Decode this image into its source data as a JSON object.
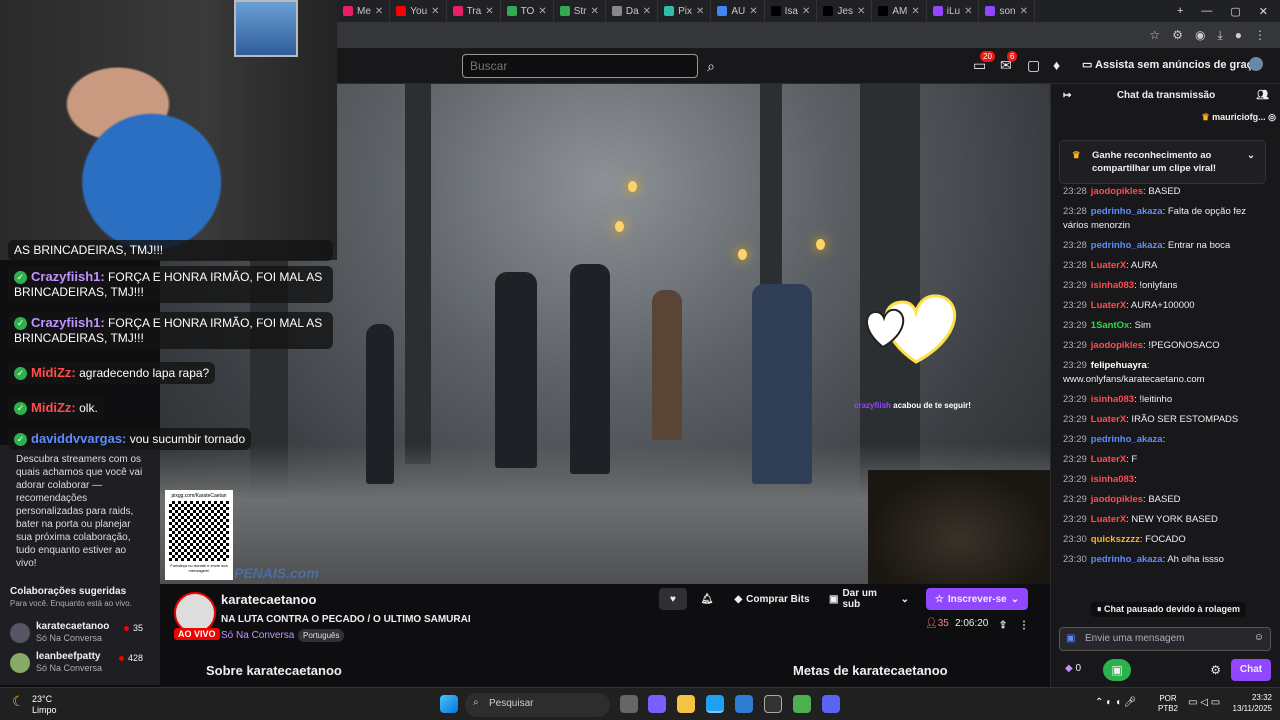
{
  "browser": {
    "tabs": [
      {
        "label": "Me",
        "color": "#e91e63"
      },
      {
        "label": "You",
        "color": "#ff0000"
      },
      {
        "label": "Tra",
        "color": "#e91e63"
      },
      {
        "label": "TO",
        "color": "#34a853"
      },
      {
        "label": "Str",
        "color": "#34a853"
      },
      {
        "label": "Da",
        "color": "#888888"
      },
      {
        "label": "Pix",
        "color": "#32bcad"
      },
      {
        "label": "AU",
        "color": "#4285f4"
      },
      {
        "label": "Isa",
        "color": "#000000"
      },
      {
        "label": "Jes",
        "color": "#000000"
      },
      {
        "label": "AM",
        "color": "#000000"
      },
      {
        "label": "iLu",
        "color": "#9147ff"
      },
      {
        "label": "son",
        "color": "#9147ff"
      }
    ]
  },
  "nav": {
    "search_placeholder": "Buscar",
    "notif_count": "20",
    "inbox_count": "6",
    "adfree_label": "Assista sem anúncios de graça"
  },
  "overlay": {
    "messages": [
      {
        "user": "",
        "text": "AS BRINCADEIRAS, TMJ!!!",
        "color": "#ffffff"
      },
      {
        "user": "Crazyfiish1:",
        "text": "FORÇA E HONRA IRMÃO, FOI MAL AS BRINCADEIRAS, TMJ!!!",
        "color": "#bf94ff"
      },
      {
        "user": "Crazyfiish1:",
        "text": "FORÇA E HONRA IRMÃO, FOI MAL AS BRINCADEIRAS, TMJ!!!",
        "color": "#bf94ff"
      },
      {
        "user": "MidiZz:",
        "text": "agradecendo lapa rapa?",
        "color": "#ff4d4d"
      },
      {
        "user": "MidiZz:",
        "text": "olk.",
        "color": "#ff4d4d"
      },
      {
        "user": "daviddvvargas:",
        "text": "vou sucumbir tornado",
        "color": "#5c8cff"
      }
    ],
    "follow_user": "crazyfiish",
    "follow_text": "acabou de te seguir!",
    "qr_url": "pixgg.com/KarateCaetan",
    "qr_caption": "Fortaleça no donate e envie sua mensagem!",
    "sign_text": "PENAIS.com"
  },
  "sidebar": {
    "description": "Descubra streamers com os quais achamos que você vai adorar colaborar — recomendações personalizadas para raids, bater na porta ou planejar sua próxima colaboração, tudo enquanto estiver ao vivo!",
    "suggested_title": "Colaborações sugeridas",
    "suggested_subtitle": "Para você. Enquanto está ao vivo.",
    "items": [
      {
        "name": "karatecaetanoo",
        "category": "Só Na Conversa",
        "viewers": "35"
      },
      {
        "name": "leanbeefpatty",
        "category": "Só Na Conversa",
        "viewers": "428"
      }
    ]
  },
  "stream": {
    "channel": "karatecaetanoo",
    "title": "NA LUTA CONTRA O PECADO / O ULTIMO SAMURAI",
    "category": "Só Na Conversa",
    "language": "Português",
    "live_label": "AO VIVO",
    "buy_bits": "Comprar Bits",
    "gift_sub": "Dar um sub",
    "subscribe": "Inscrever-se",
    "viewers": "35",
    "uptime": "2:06:20",
    "about": "Sobre karatecaetanoo",
    "goals": "Metas de karatecaetanoo"
  },
  "chat": {
    "header": "Chat da transmissão",
    "pinned_user": "mauriciofg...",
    "clip_prompt": "Ganhe reconhecimento ao compartilhar um clipe viral!",
    "messages": [
      {
        "time": "23:28",
        "user": "jaodopikles",
        "color": "#ff4d4d",
        "text": ": BASED"
      },
      {
        "time": "23:28",
        "user": "pedrinho_akaza",
        "color": "#5c8cff",
        "text": ": Falta de opção fez vários menorzin"
      },
      {
        "time": "23:28",
        "user": "pedrinho_akaza",
        "color": "#5c8cff",
        "text": ": Entrar na boca"
      },
      {
        "time": "23:28",
        "user": "LuaterX",
        "color": "#ff4d4d",
        "text": ": AURA"
      },
      {
        "time": "23:29",
        "user": "isinha083",
        "color": "#ff4d4d",
        "text": ": !onlyfans"
      },
      {
        "time": "23:29",
        "user": "LuaterX",
        "color": "#ff4d4d",
        "text": ": AURA+100000"
      },
      {
        "time": "23:29",
        "user": "1SantOx",
        "color": "#2bd94c",
        "text": ": Sim"
      },
      {
        "time": "23:29",
        "user": "jaodopikles",
        "color": "#ff4d4d",
        "text": ": !PEGONOSACO"
      },
      {
        "time": "23:29",
        "user": "felipehuayra",
        "color": "#ffffff",
        "text": ": www.onlyfans/karatecaetano.com"
      },
      {
        "time": "23:29",
        "user": "isinha083",
        "color": "#ff4d4d",
        "text": ": !leitinho"
      },
      {
        "time": "23:29",
        "user": "LuaterX",
        "color": "#ff4d4d",
        "text": ": IRÃO SER ESTOMPADS"
      },
      {
        "time": "23:29",
        "user": "pedrinho_akaza",
        "color": "#5c8cff",
        "text": ":"
      },
      {
        "time": "23:29",
        "user": "LuaterX",
        "color": "#ff4d4d",
        "text": ": F"
      },
      {
        "time": "23:29",
        "user": "isinha083",
        "color": "#ff4d4d",
        "text": ":"
      },
      {
        "time": "23:29",
        "user": "jaodopikles",
        "color": "#ff4d4d",
        "text": ": BASED"
      },
      {
        "time": "23:29",
        "user": "LuaterX",
        "color": "#ff4d4d",
        "text": ": NEW YORK BASED"
      },
      {
        "time": "23:30",
        "user": "quickszzzz",
        "color": "#ffb31a",
        "text": ": FOCADO"
      },
      {
        "time": "23:30",
        "user": "pedrinho_akaza",
        "color": "#5c8cff",
        "text": ": Ah olha issso"
      }
    ],
    "paused": "Chat pausado devido à rolagem",
    "input_placeholder": "Envie uma mensagem",
    "points": "0",
    "chat_button": "Chat"
  },
  "taskbar": {
    "temp": "23°C",
    "weather": "Limpo",
    "search": "Pesquisar",
    "lang1": "POR",
    "lang2": "PTB2",
    "time": "23:32",
    "date": "13/11/2025"
  }
}
